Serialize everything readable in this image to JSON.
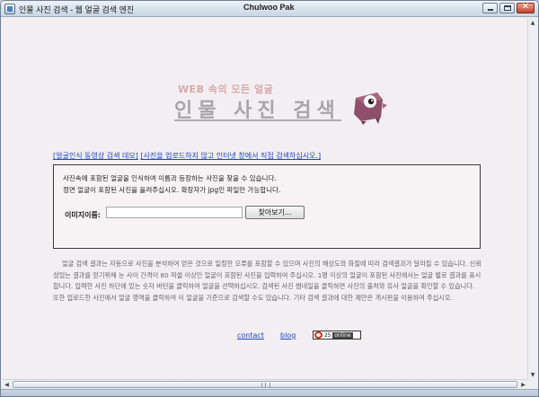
{
  "window": {
    "title": "인물 사진 검색 - 웹 얼굴 검색 엔진",
    "user": "Chulwoo Pak"
  },
  "logo": {
    "subtitle": "WEB 속의 모든 얼굴",
    "main": "인물 사진 검색"
  },
  "links": {
    "demo": "[얼굴인식 동영상 검색 데모]",
    "no_upload": "[사진을 업로드하지 않고 인터넷 창에서 직접 검색하십시오.]"
  },
  "upload": {
    "line1": "사진속에 포함된 얼굴을 인식하여 이름과 등장하는 사진을 찾을 수 있습니다.",
    "line2": "정면 얼굴이 포함된 사진을 올려주십시오. 확장자가 jpg인 파일만 가능합니다.",
    "file_label": "이미지이름:",
    "file_value": "",
    "browse_label": "찾아보기..."
  },
  "description": "얼굴 검색 결과는 자동으로 사진을 분석하여 얻은 것으로 일정한 오류를 포함할 수 있으며 사진의 해상도와 화질에 따라 검색결과가 달라질 수 있습니다. 신뢰성있는 결과를 얻기위해 눈 사이 간격이 80 픽셀 이상인 얼굴이 포함된 사진을 입력하여 주십시오. 1명 이상의 얼굴이 포함된 사진에서는 얼굴 별로 결과를 표시합니다. 입력한 사진 하단에 있는 숫자 버턴을 클릭하여 얼굴을 선택하십시오. 검색된 사진 썸네일을 클릭하면 사진의 출처와 유사 얼굴을 확인할 수 있습니다. 또한 업로드한 사진에서 얼굴 영역을 클릭하여 이 얼굴을 기준으로 검색할 수도 있습니다. 기타 검색 결과에 대한 제안은 게시판을 이용하여 주십시오.",
  "footer": {
    "contact": "contact",
    "blog": "blog",
    "counter_num": "25",
    "counter_word": "online"
  },
  "colors": {
    "link": "#1a45c4",
    "background": "#f3eef1",
    "logo_text": "#a9a4a7",
    "logo_sub": "#d6a9a9",
    "mascot": "#8e4f6b"
  }
}
